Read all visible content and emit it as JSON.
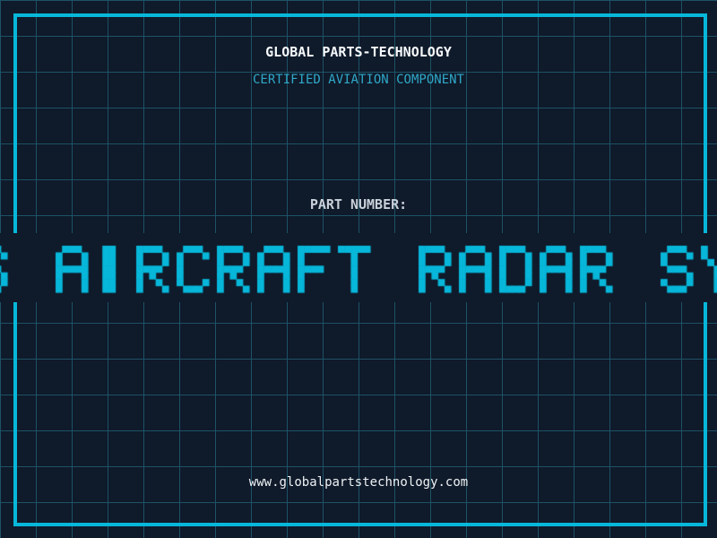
{
  "header": {
    "title": "GLOBAL PARTS-TECHNOLOGY",
    "subtitle": "CERTIFIED AVIATION COMPONENT"
  },
  "part": {
    "label": "PART NUMBER:"
  },
  "marquee": {
    "text": "S AIRCRAFT RADAR SY"
  },
  "footer": {
    "url": "www.globalpartstechnology.com"
  },
  "colors": {
    "background": "#0f1a2a",
    "grid_line": "#1d5266",
    "frame": "#07b7da",
    "marquee_text": "#07b7da",
    "title": "#f7fafc",
    "subtitle": "#2fa8c8",
    "part_label": "#c9d1da",
    "url": "#eef2f5"
  }
}
